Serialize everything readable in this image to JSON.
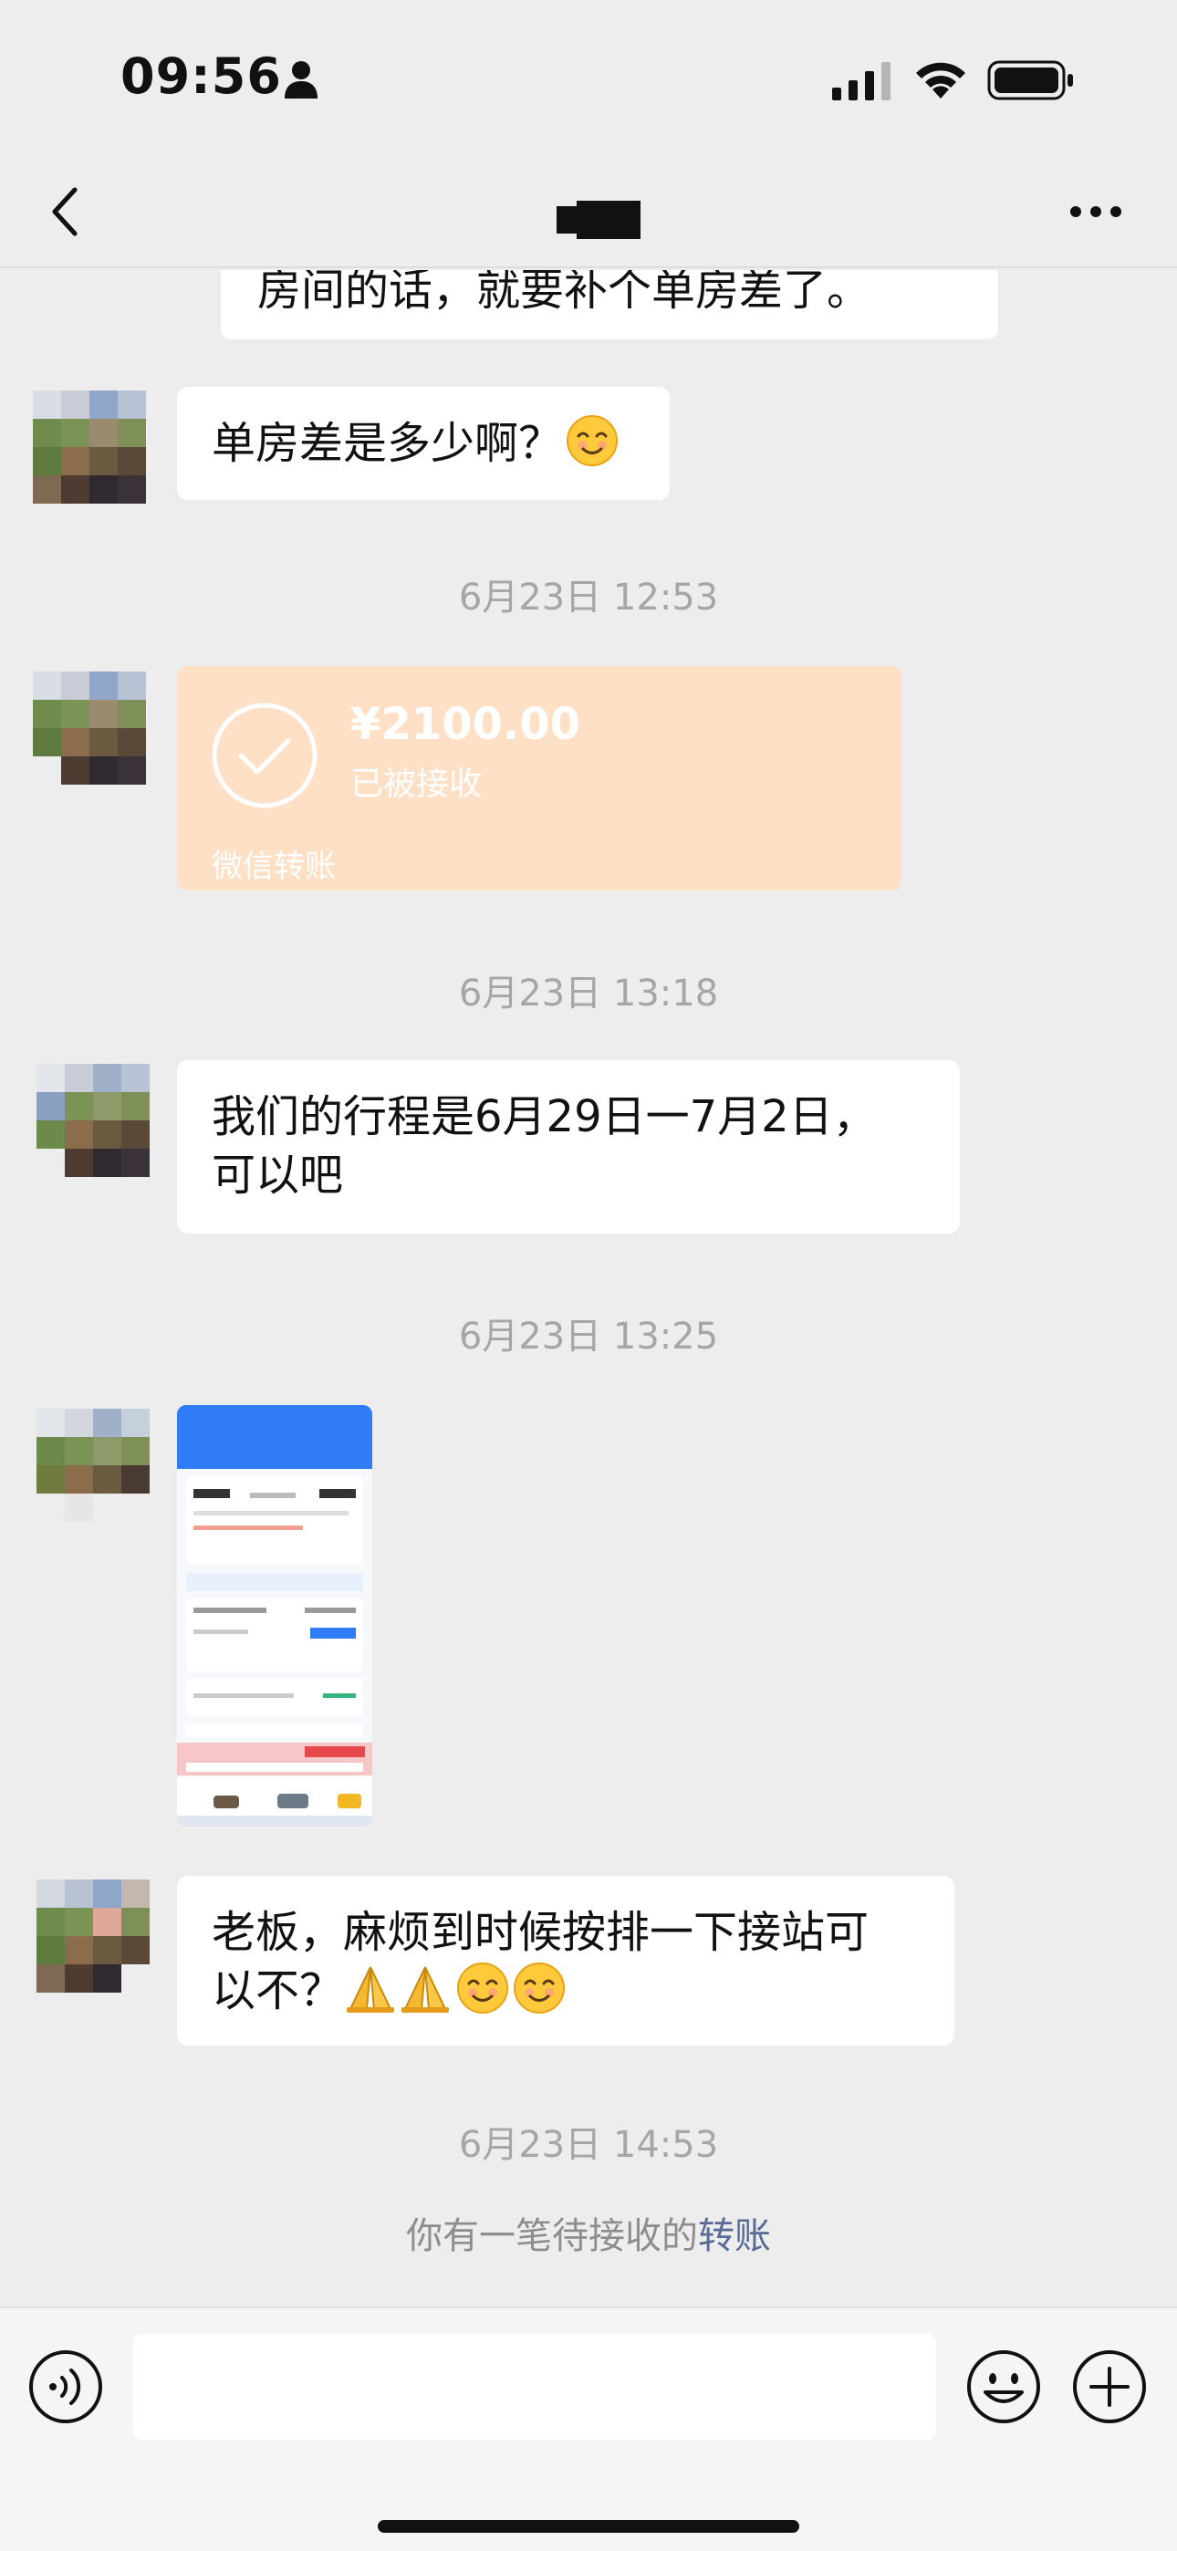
{
  "status_bar": {
    "time": "09:56"
  },
  "nav": {
    "back_icon": "chevron-left-icon",
    "more_icon": "more-dots-icon"
  },
  "messages": {
    "partial_text": "房间的话，就要补个单房差了。",
    "single_room_question": "单房差是多少啊？",
    "timestamp_1": "6月23日 12:53",
    "transfer": {
      "amount": "¥2100.00",
      "status": "已被接收",
      "label": "微信转账",
      "color": "#fde0c5"
    },
    "timestamp_2": "6月23日 13:18",
    "itinerary_line1": "我们的行程是6月29日一7月2日，",
    "itinerary_line2": "可以吧",
    "timestamp_3": "6月23日 13:25",
    "pickup_line1": "老板，麻烦到时候按排一下接站可",
    "pickup_line2": "以不？",
    "timestamp_4": "6月23日 14:53",
    "pending_prefix": "你有一笔待接收的",
    "pending_link": "转账"
  },
  "input_bar": {
    "voice_icon": "voice-icon",
    "emoji_icon": "emoji-icon",
    "plus_icon": "plus-icon"
  }
}
